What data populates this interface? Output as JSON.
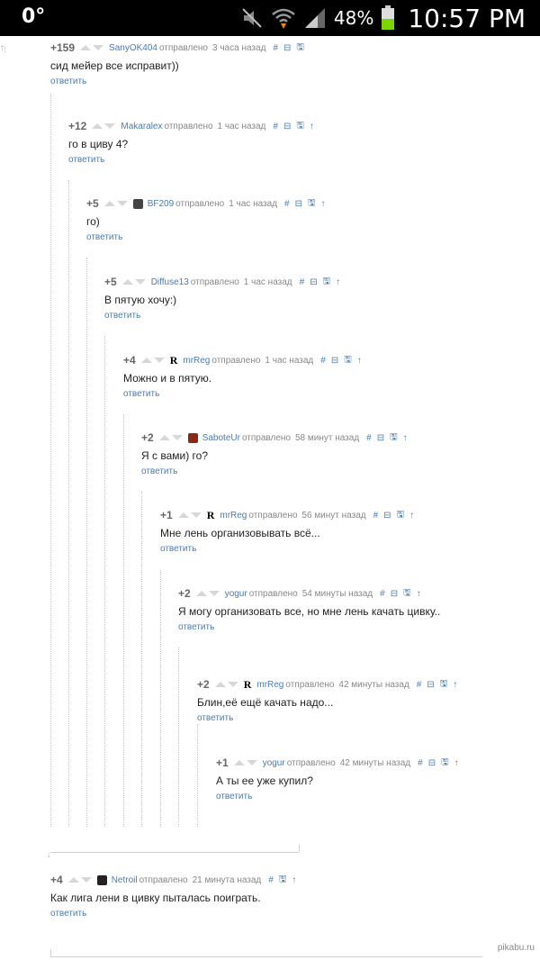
{
  "statusbar": {
    "temperature": "0°",
    "battery_pct": "48%",
    "time": "10:57 PM"
  },
  "comments": [
    {
      "rating": "+159",
      "author": "SanyOK404",
      "verb": "отправлено",
      "time": "3 часа назад",
      "text": "сид мейер все исправит))",
      "reply": "ответить",
      "avatar": ""
    },
    {
      "rating": "+12",
      "author": "Makaralex",
      "verb": "отправлено",
      "time": "1 час назад",
      "text": "го в циву 4?",
      "reply": "ответить",
      "avatar": ""
    },
    {
      "rating": "+5",
      "author": "BF209",
      "verb": "отправлено",
      "time": "1 час назад",
      "text": "го)",
      "reply": "ответить",
      "avatar": "img"
    },
    {
      "rating": "+5",
      "author": "Diffuse13",
      "verb": "отправлено",
      "time": "1 час назад",
      "text": "В пятую хочу:)",
      "reply": "ответить",
      "avatar": ""
    },
    {
      "rating": "+4",
      "author": "mrReg",
      "verb": "отправлено",
      "time": "1 час назад",
      "text": "Можно и в пятую.",
      "reply": "ответить",
      "avatar": "R"
    },
    {
      "rating": "+2",
      "author": "SaboteUr",
      "verb": "отправлено",
      "time": "58 минут назад",
      "text": "Я с вами) го?",
      "reply": "ответить",
      "avatar": "img"
    },
    {
      "rating": "+1",
      "author": "mrReg",
      "verb": "отправлено",
      "time": "56 минут назад",
      "text": "Мне лень организовывать всё...",
      "reply": "ответить",
      "avatar": "R"
    },
    {
      "rating": "+2",
      "author": "yogur",
      "verb": "отправлено",
      "time": "54 минуты назад",
      "text": "Я могу организовать все, но мне лень качать цивку..",
      "reply": "ответить",
      "avatar": ""
    },
    {
      "rating": "+2",
      "author": "mrReg",
      "verb": "отправлено",
      "time": "42 минуты назад",
      "text": "Блин,её ещё качать надо...",
      "reply": "ответить",
      "avatar": "R"
    },
    {
      "rating": "+1",
      "author": "yogur",
      "verb": "отправлено",
      "time": "42 минуты назад",
      "text": "А ты ее уже купил?",
      "reply": "ответить",
      "avatar": ""
    },
    {
      "rating": "+4",
      "author": "Netroil",
      "verb": "отправлено",
      "time": "21 минута назад",
      "text": "Как лига лени в цивку пыталась поиграть.",
      "reply": "ответить",
      "avatar": "img"
    }
  ],
  "avatar_letter": "R",
  "actions": {
    "link": "#",
    "collapse": "⊟",
    "save": "🖫",
    "parent": "↑"
  },
  "watermark": "pikabu.ru"
}
